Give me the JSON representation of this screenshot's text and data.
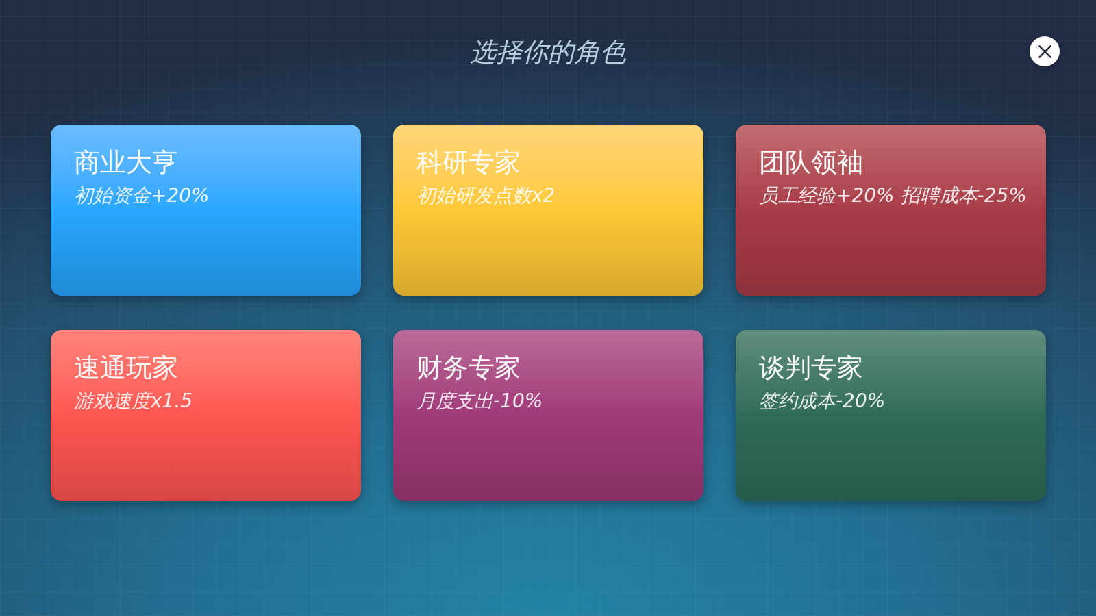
{
  "title": "选择你的角色",
  "cards": [
    {
      "name": "商业大亨",
      "bonus": "初始资金+20%",
      "color": "#28a6ff"
    },
    {
      "name": "科研专家",
      "bonus": "初始研发点数x2",
      "color": "#ffc837"
    },
    {
      "name": "团队领袖",
      "bonus": "员工经验+20% 招聘成本-25%",
      "color": "#a83c48"
    },
    {
      "name": "速通玩家",
      "bonus": "游戏速度x1.5",
      "color": "#ff5652"
    },
    {
      "name": "财务专家",
      "bonus": "月度支出-10%",
      "color": "#a03a7a"
    },
    {
      "name": "谈判专家",
      "bonus": "签约成本-20%",
      "color": "#2f6c58"
    }
  ]
}
